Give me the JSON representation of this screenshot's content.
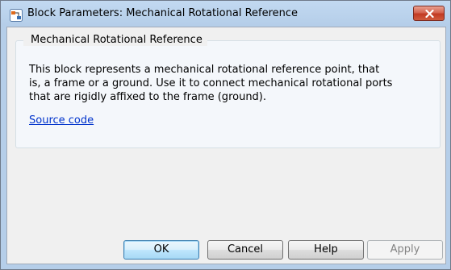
{
  "window": {
    "title": "Block Parameters: Mechanical Rotational Reference",
    "app_icon": "simulink-block-icon",
    "close_icon": "close-icon"
  },
  "group": {
    "legend": "Mechanical Rotational Reference",
    "description": "This block represents a mechanical rotational reference point, that\nis, a frame or a ground. Use it to connect mechanical rotational ports\nthat are rigidly affixed to the frame (ground).",
    "source_link": "Source code"
  },
  "buttons": {
    "ok": "OK",
    "cancel": "Cancel",
    "help": "Help",
    "apply": "Apply"
  },
  "colors": {
    "title_bar": "#b5cee9",
    "close_button": "#c23a22",
    "link": "#0033cc",
    "dialog_background": "#f0f0f0",
    "disabled_text": "#838383"
  }
}
